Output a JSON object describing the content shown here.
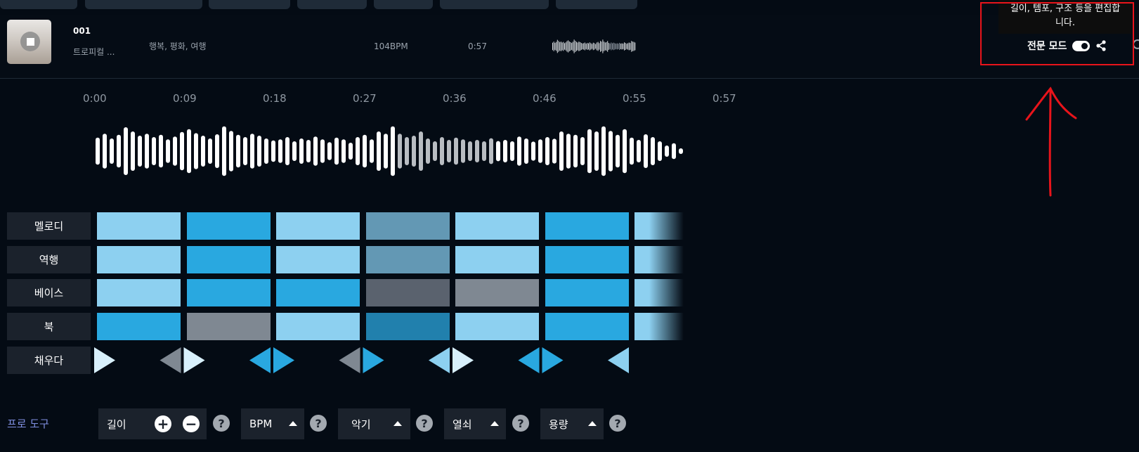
{
  "track": {
    "number": "001",
    "name": "트로피컬 ...",
    "tags": "행복, 평화, 여행",
    "bpm": "104BPM",
    "duration": "0:57"
  },
  "header": {
    "tooltip_line1": "길이, 템포, 구조 등을 편집합",
    "tooltip_line2": "니다.",
    "pro_mode_label": "전문 모드",
    "pro_mode_on": true
  },
  "timeline": {
    "ticks": [
      "0:00",
      "0:09",
      "0:18",
      "0:27",
      "0:36",
      "0:46",
      "0:55",
      "0:57"
    ]
  },
  "waveform": {
    "amplitudes": [
      0.48,
      0.62,
      0.45,
      0.58,
      0.85,
      0.7,
      0.55,
      0.62,
      0.5,
      0.58,
      0.42,
      0.52,
      0.68,
      0.78,
      0.64,
      0.55,
      0.45,
      0.6,
      0.88,
      0.72,
      0.58,
      0.5,
      0.62,
      0.55,
      0.45,
      0.38,
      0.42,
      0.5,
      0.35,
      0.45,
      0.4,
      0.52,
      0.42,
      0.32,
      0.48,
      0.42,
      0.3,
      0.5,
      0.58,
      0.42,
      0.7,
      0.62,
      0.88,
      0.62,
      0.5,
      0.55,
      0.7,
      0.45,
      0.35,
      0.5,
      0.4,
      0.48,
      0.42,
      0.35,
      0.4,
      0.35,
      0.46,
      0.36,
      0.4,
      0.35,
      0.52,
      0.45,
      0.34,
      0.42,
      0.5,
      0.44,
      0.7,
      0.62,
      0.58,
      0.5,
      0.78,
      0.7,
      0.88,
      0.72,
      0.58,
      0.78,
      0.48,
      0.4,
      0.6,
      0.5,
      0.35,
      0.2,
      0.28,
      0.1
    ],
    "highlight_start": 43,
    "highlight_end": 56
  },
  "grid": {
    "rows": [
      {
        "label": "멜로디",
        "cells": [
          "#8dd0f0",
          "#29a8e0",
          "#8dd0f0",
          "#6398b4",
          "#8dd0f0",
          "#29a8e0",
          "#8dd0f0"
        ]
      },
      {
        "label": "역행",
        "cells": [
          "#8dd0f0",
          "#29a8e0",
          "#8dd0f0",
          "#6398b4",
          "#8dd0f0",
          "#29a8e0",
          "#8dd0f0"
        ]
      },
      {
        "label": "베이스",
        "cells": [
          "#8dd0f0",
          "#29a8e0",
          "#29a8e0",
          "#5a626e",
          "#7f8892",
          "#29a8e0",
          "#8dd0f0"
        ]
      },
      {
        "label": "북",
        "cells": [
          "#29a8e0",
          "#7f8892",
          "#8dd0f0",
          "#2180ad",
          "#8dd0f0",
          "#29a8e0",
          "#8dd0f0"
        ]
      }
    ],
    "fill_label": "채우다",
    "fill_triangles": [
      {
        "slot": 0,
        "dir": "right",
        "color": "#d8f0fc"
      },
      {
        "slot": 1,
        "dir": "left",
        "color": "#7f8892"
      },
      {
        "slot": 1,
        "dir": "right",
        "color": "#d8f0fc"
      },
      {
        "slot": 2,
        "dir": "left",
        "color": "#29a8e0"
      },
      {
        "slot": 2,
        "dir": "right",
        "color": "#29a8e0"
      },
      {
        "slot": 3,
        "dir": "left",
        "color": "#7f8892"
      },
      {
        "slot": 3,
        "dir": "right",
        "color": "#29a8e0"
      },
      {
        "slot": 4,
        "dir": "left",
        "color": "#8dd0f0"
      },
      {
        "slot": 4,
        "dir": "right",
        "color": "#d8f0fc"
      },
      {
        "slot": 5,
        "dir": "left",
        "color": "#29a8e0"
      },
      {
        "slot": 5,
        "dir": "right",
        "color": "#29a8e0"
      },
      {
        "slot": 6,
        "dir": "left",
        "color": "#8dd0f0"
      }
    ]
  },
  "pro_tools": {
    "label": "프로 도구",
    "length": "길이",
    "bpm": "BPM",
    "instrument": "악기",
    "key": "열쇠",
    "volume": "용량"
  },
  "colors": {
    "background": "#040b14",
    "accent_blue": "#29a8e0",
    "annotation_red": "#e8141b",
    "pro_tools_label": "#7f8fe0"
  }
}
